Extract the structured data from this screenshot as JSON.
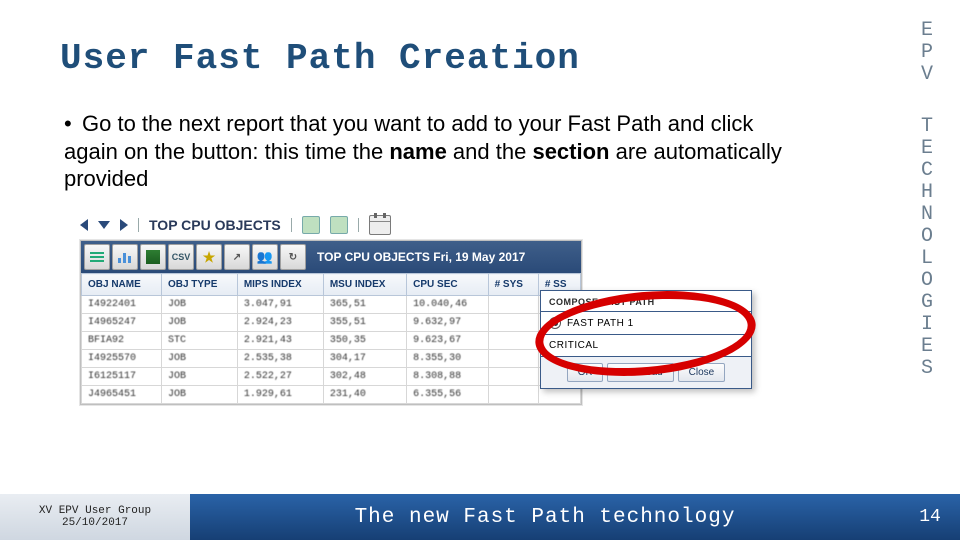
{
  "title": "User Fast Path Creation",
  "right_col_1": [
    "E",
    "P",
    "V"
  ],
  "right_col_2": [
    "T",
    "E",
    "C",
    "H",
    "N",
    "O",
    "L",
    "O",
    "G",
    "I",
    "E",
    "S"
  ],
  "bullet": {
    "prefix": "Go to the next report that you want to add to your Fast Path and click again on the button: this time the ",
    "em1": "name",
    "mid": " and the ",
    "em2": "section",
    "suffix": " are automatically provided"
  },
  "mini_toolbar_label": "TOP CPU OBJECTS",
  "shot": {
    "title": "TOP CPU OBJECTS Fri, 19 May 2017",
    "headers": [
      "OBJ NAME",
      "OBJ TYPE",
      "MIPS INDEX",
      "MSU INDEX",
      "CPU SEC",
      "# SYS",
      "# SS"
    ],
    "rows": [
      [
        "I4922401",
        "JOB",
        "3.047,91",
        "365,51",
        "10.040,46",
        "",
        ""
      ],
      [
        "I4965247",
        "JOB",
        "2.924,23",
        "355,51",
        "9.632,97",
        "",
        ""
      ],
      [
        "BFIA92",
        "STC",
        "2.921,43",
        "350,35",
        "9.623,67",
        "",
        ""
      ],
      [
        "I4925570",
        "JOB",
        "2.535,38",
        "304,17",
        "8.355,30",
        "",
        ""
      ],
      [
        "I6125117",
        "JOB",
        "2.522,27",
        "302,48",
        "8.308,88",
        "",
        ""
      ],
      [
        "J4965451",
        "JOB",
        "1.929,61",
        "231,40",
        "6.355,56",
        "",
        ""
      ]
    ]
  },
  "popup": {
    "title": "COMPOSE FAST PATH",
    "radio_label": "FAST PATH 1",
    "text_value": "CRITICAL",
    "buttons": {
      "ok": "OK",
      "download": "Download",
      "close": "Close"
    }
  },
  "footer": {
    "group_line1": "XV EPV User Group",
    "group_line2": "25/10/2017",
    "center": "The new Fast Path technology",
    "page": "14"
  }
}
